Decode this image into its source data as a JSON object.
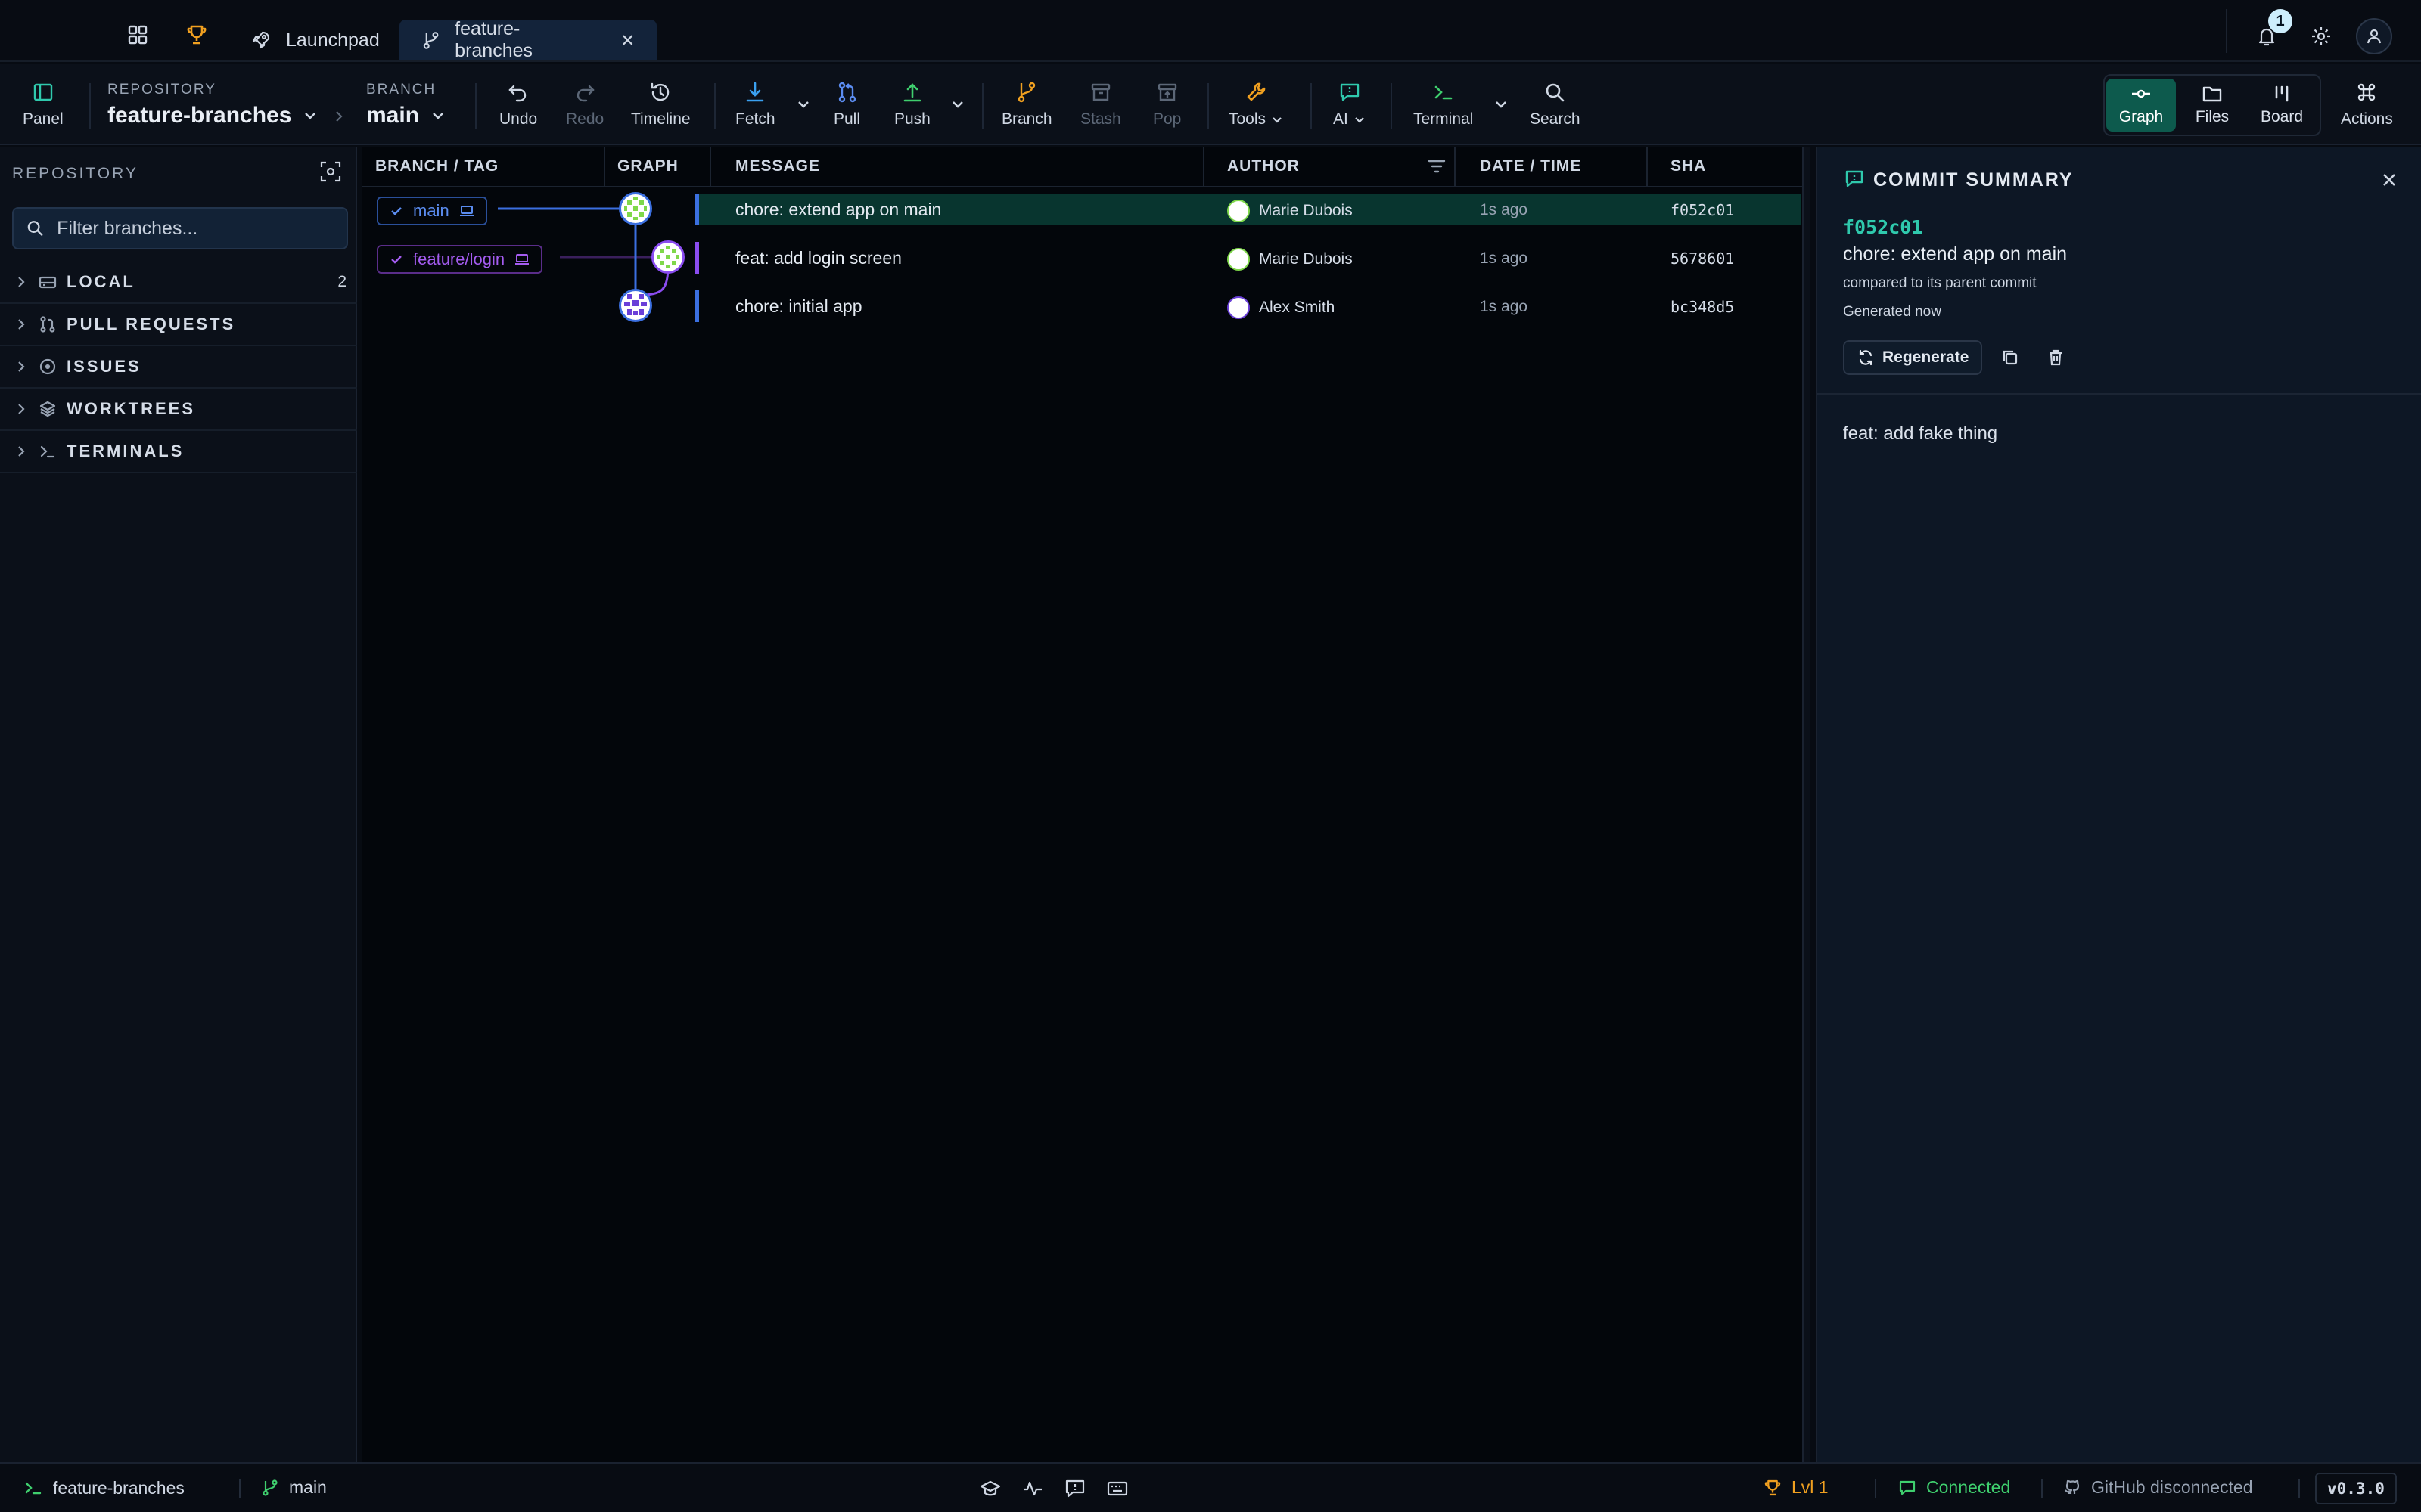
{
  "tabs": {
    "launchpad": "Launchpad",
    "repo_tab": "feature-branches",
    "notifications_count": "1"
  },
  "toolbar": {
    "panel": "Panel",
    "repository_label": "REPOSITORY",
    "repository_value": "feature-branches",
    "branch_label": "BRANCH",
    "branch_value": "main",
    "undo": "Undo",
    "redo": "Redo",
    "timeline": "Timeline",
    "fetch": "Fetch",
    "pull": "Pull",
    "push": "Push",
    "branch": "Branch",
    "stash": "Stash",
    "pop": "Pop",
    "tools": "Tools",
    "ai": "AI",
    "terminal": "Terminal",
    "search": "Search",
    "views": [
      "Graph",
      "Files",
      "Board"
    ],
    "actions": "Actions"
  },
  "sidebar": {
    "title": "REPOSITORY",
    "filter_placeholder": "Filter branches...",
    "sections": [
      {
        "label": "LOCAL",
        "count": "2",
        "icon": "drive-icon"
      },
      {
        "label": "PULL REQUESTS",
        "count": "",
        "icon": "pull-request-icon"
      },
      {
        "label": "ISSUES",
        "count": "",
        "icon": "issue-icon"
      },
      {
        "label": "WORKTREES",
        "count": "",
        "icon": "layers-icon"
      },
      {
        "label": "TERMINALS",
        "count": "",
        "icon": "terminal-icon"
      }
    ]
  },
  "graph": {
    "columns": [
      "BRANCH / TAG",
      "GRAPH",
      "MESSAGE",
      "AUTHOR",
      "DATE / TIME",
      "SHA"
    ],
    "rows": [
      {
        "branch": "main",
        "message": "chore: extend app on main",
        "author": "Marie Dubois",
        "time": "1s ago",
        "sha": "f052c01"
      },
      {
        "branch": "feature/login",
        "message": "feat: add login screen",
        "author": "Marie Dubois",
        "time": "1s ago",
        "sha": "5678601"
      },
      {
        "branch": "",
        "message": "chore: initial app",
        "author": "Alex Smith",
        "time": "1s ago",
        "sha": "bc348d5"
      }
    ]
  },
  "summary": {
    "title": "COMMIT SUMMARY",
    "sha": "f052c01",
    "message": "chore: extend app on main",
    "compared": "compared to its parent commit",
    "generated": "Generated now",
    "regenerate": "Regenerate",
    "body": "feat: add fake thing"
  },
  "status": {
    "repo": "feature-branches",
    "branch": "main",
    "level": "Lvl 1",
    "connection": "Connected",
    "github": "GitHub disconnected",
    "version": "v0.3.0"
  },
  "colors": {
    "accent_teal": "#2fc9ad",
    "main_branch": "#5b8cf0",
    "feature_branch": "#a45cf0",
    "selected_row": "#08352f",
    "trophy": "#f0a020"
  }
}
